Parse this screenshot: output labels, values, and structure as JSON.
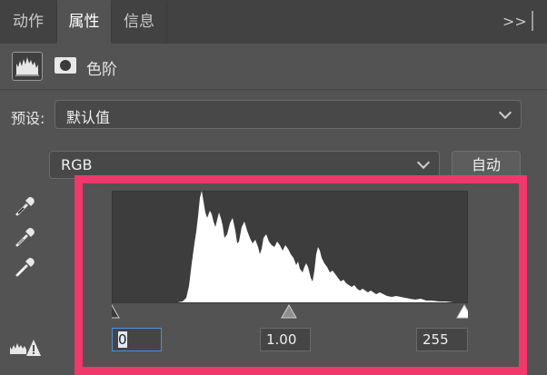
{
  "tabs": [
    {
      "label": "动作",
      "active": false
    },
    {
      "label": "属性",
      "active": true
    },
    {
      "label": "信息",
      "active": false
    }
  ],
  "tab_collapse_label": ">>",
  "panel": {
    "title": "色阶",
    "type_icon": "levels-adjustment-icon",
    "mask_icon": "layer-mask-icon"
  },
  "preset": {
    "label": "预设:",
    "value": "默认值"
  },
  "channel": {
    "value": "RGB",
    "auto_label": "自动"
  },
  "eyedroppers": [
    "black-point-eyedropper-icon",
    "gray-point-eyedropper-icon",
    "white-point-eyedropper-icon"
  ],
  "input_levels": {
    "black": "0",
    "gamma": "1.00",
    "white": "255"
  },
  "colors": {
    "accent_highlight": "#f0386b",
    "focus_border": "#4f8fdb"
  }
}
